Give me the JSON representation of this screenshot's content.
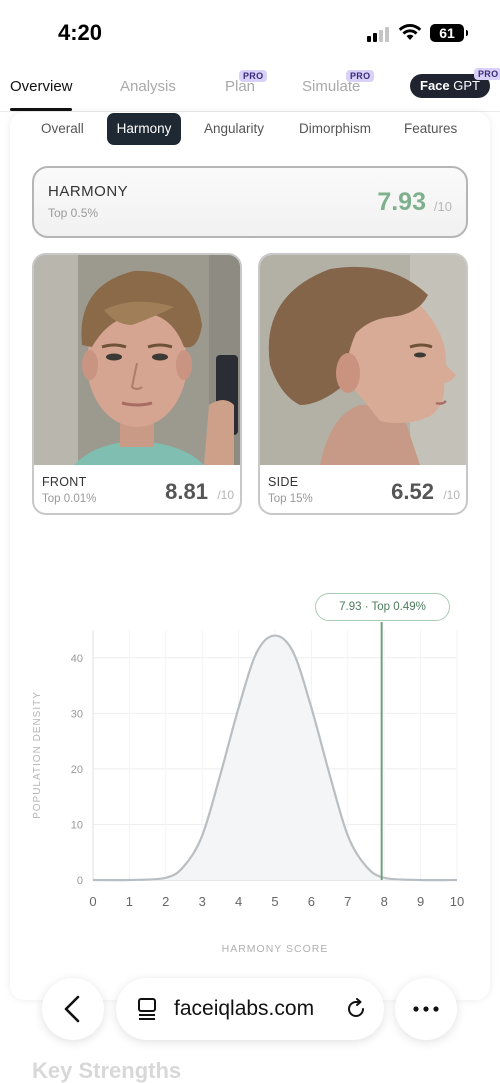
{
  "status_bar": {
    "time": "4:20",
    "battery": "61"
  },
  "top_nav": {
    "tabs": [
      {
        "label": "Overview",
        "active": true
      },
      {
        "label": "Analysis"
      },
      {
        "label": "Plan",
        "badge": "PRO"
      },
      {
        "label": "Simulate",
        "badge": "PRO"
      }
    ],
    "facegpt": {
      "bold": "Face",
      "rest": "GPT",
      "badge": "PRO"
    }
  },
  "sub_tabs": [
    "Overall",
    "Harmony",
    "Angularity",
    "Dimorphism",
    "Features"
  ],
  "harmony_card": {
    "label": "HARMONY",
    "sub": "Top 0.5%",
    "score": "7.93",
    "denominator": "/10"
  },
  "photos": [
    {
      "label": "FRONT",
      "top": "Top 0.01%",
      "score": "8.81",
      "denominator": "/10"
    },
    {
      "label": "SIDE",
      "top": "Top 15%",
      "score": "6.52",
      "denominator": "/10"
    }
  ],
  "chart_data": {
    "type": "area",
    "xlabel": "HARMONY SCORE",
    "ylabel": "POPULATION DENSITY",
    "xlim": [
      0,
      10
    ],
    "ylim": [
      0,
      45
    ],
    "x_ticks": [
      "0",
      "1",
      "2",
      "3",
      "4",
      "5",
      "6",
      "7",
      "8",
      "9",
      "10"
    ],
    "y_ticks": [
      "0",
      "10",
      "20",
      "30",
      "40"
    ],
    "grid": true,
    "series": [
      {
        "x": [
          0,
          1,
          2,
          2.5,
          3,
          3.5,
          4,
          4.5,
          5,
          5.5,
          6,
          6.5,
          7,
          7.5,
          8,
          9,
          10
        ],
        "y": [
          0,
          0,
          0.4,
          2.5,
          8,
          19,
          31,
          41,
          44,
          41,
          31,
          19,
          8,
          2.5,
          0.4,
          0,
          0
        ]
      }
    ],
    "marker": {
      "x": 7.93,
      "label": "7.93 · Top 0.49%",
      "color": "#6fa080"
    }
  },
  "browser": {
    "url": "faceiqlabs.com"
  },
  "below_fold": {
    "heading": "Key Strengths"
  }
}
